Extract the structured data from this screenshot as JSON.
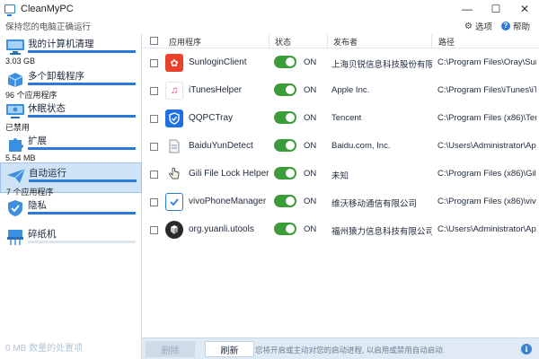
{
  "window": {
    "title": "CleanMyPC",
    "minimize": "—",
    "maximize": "☐",
    "close": "✕"
  },
  "subbar": {
    "tagline": "保持您的电脑正确运行",
    "settings": "选项",
    "help": "帮助"
  },
  "sidebar": {
    "items": [
      {
        "label": "我的计算机清理",
        "sub": "3.03 GB",
        "progress": 1.0
      },
      {
        "label": "多个卸载程序",
        "sub": "96 个应用程序",
        "progress": 1.0
      },
      {
        "label": "休眠状态",
        "sub": "已禁用",
        "progress": 1.0
      },
      {
        "label": "扩展",
        "sub": "5.54 MB",
        "progress": 1.0
      },
      {
        "label": "自动运行",
        "sub": "7 个应用程序",
        "progress": 1.0
      },
      {
        "label": "隐私",
        "sub": "",
        "progress": 1.0
      },
      {
        "label": "碎纸机",
        "sub": "",
        "progress": 0.0
      }
    ],
    "footer": "0 MB 数量的处置项"
  },
  "table": {
    "headers": {
      "app": "应用程序",
      "status": "状态",
      "publisher": "发布者",
      "path": "路径"
    },
    "rows": [
      {
        "name": "SunloginClient",
        "on": "ON",
        "publisher": "上海贝锐信息科技股份有限公司",
        "path": "C:\\Program  Files\\Oray\\SunLo..."
      },
      {
        "name": "iTunesHelper",
        "on": "ON",
        "publisher": "Apple Inc.",
        "path": "C:\\Program  Files\\iTunes\\iTun..."
      },
      {
        "name": "QQPCTray",
        "on": "ON",
        "publisher": "Tencent",
        "path": "C:\\Program  Files  (x86)\\Tence..."
      },
      {
        "name": "BaiduYunDetect",
        "on": "ON",
        "publisher": "Baidu.com, Inc.",
        "path": "C:\\Users\\Administrator\\AppD..."
      },
      {
        "name": "Gili File Lock Helper",
        "on": "ON",
        "publisher": "未知",
        "path": "C:\\Program  Files  (x86)\\GiliSof..."
      },
      {
        "name": "vivoPhoneManager",
        "on": "ON",
        "publisher": "维沃移动通信有限公司",
        "path": "C:\\Program  Files  (x86)\\vivo\\vi..."
      },
      {
        "name": "org.yuanli.utools",
        "on": "ON",
        "publisher": "福州猿力信息科技有限公司",
        "path": "C:\\Users\\Administrator\\AppD..."
      }
    ]
  },
  "bottombar": {
    "delete": "删除",
    "refresh": "刷新",
    "hint": "您将开启或主动对您的启动进程, 以启用或禁用自动启动.",
    "info": "i"
  },
  "colors": {
    "accent": "#2b7ad6",
    "toggle_on": "#3d9c3a",
    "sidebar_active": "#cfe3f6"
  }
}
